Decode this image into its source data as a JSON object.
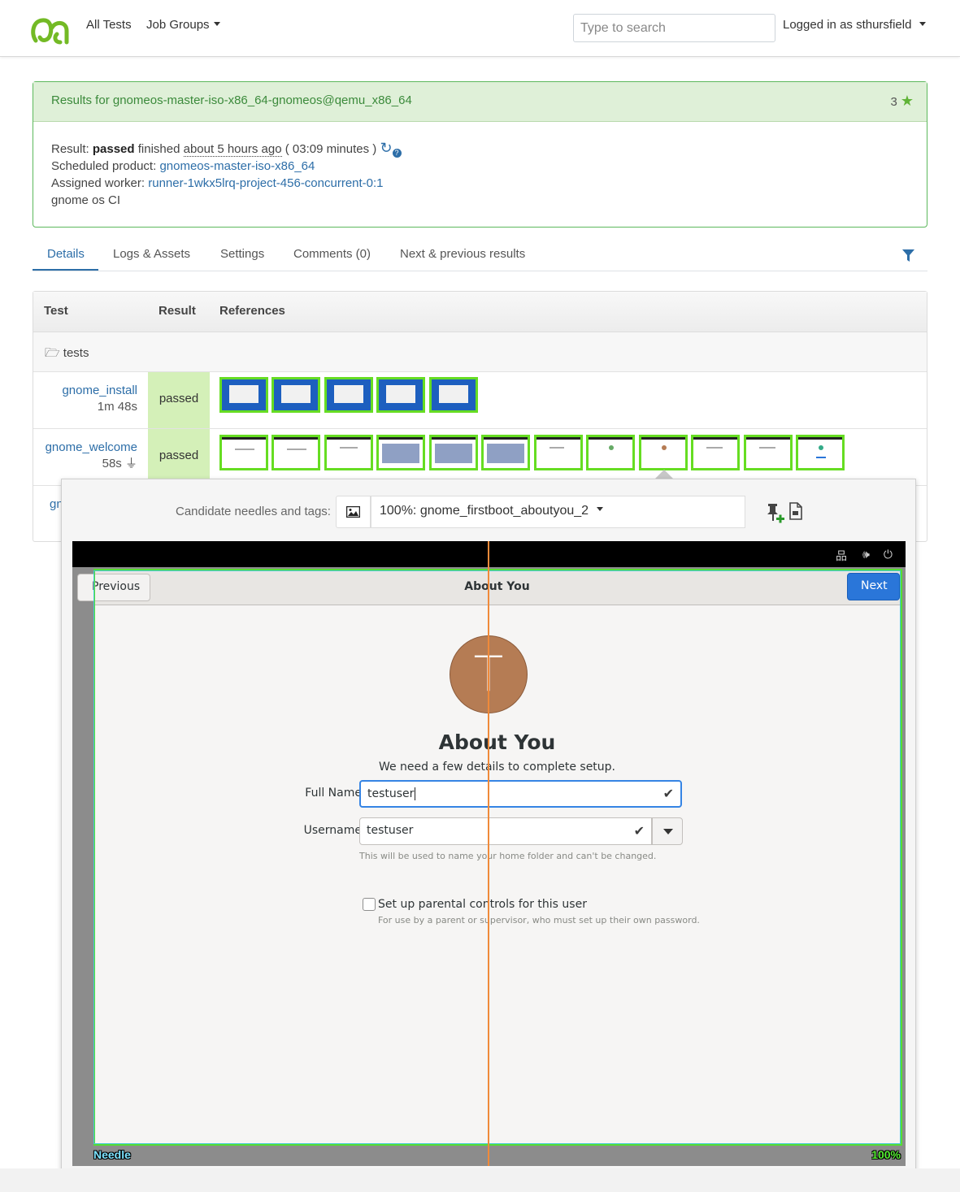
{
  "navbar": {
    "links": [
      "All Tests",
      "Job Groups"
    ],
    "search_placeholder": "Type to search",
    "user_label": "Logged in as sthursfield"
  },
  "result_card": {
    "title": "Results for gnomeos-master-iso-x86_64-gnomeos@qemu_x86_64",
    "stars": "3",
    "result_label": "Result:",
    "result_value": "passed",
    "finished_text": "finished",
    "finished_ago": "about 5 hours ago",
    "duration": "( 03:09 minutes )",
    "product_label": "Scheduled product:",
    "product_value": "gnomeos-master-iso-x86_64",
    "worker_label": "Assigned worker:",
    "worker_value": "runner-1wkx5lrq-project-456-concurrent-0:1",
    "note": "gnome os CI"
  },
  "tabs": [
    "Details",
    "Logs & Assets",
    "Settings",
    "Comments (0)",
    "Next & previous results"
  ],
  "table": {
    "headers": [
      "Test",
      "Result",
      "References"
    ],
    "folder": "tests",
    "rows": [
      {
        "name": "gnome_install",
        "duration": "1m 48s",
        "result": "passed",
        "thumb_count": 5
      },
      {
        "name": "gnome_welcome",
        "duration": "58s",
        "result": "passed",
        "thumb_count": 12
      }
    ],
    "partial_row_name": "gn"
  },
  "preview": {
    "candidate_label": "Candidate needles and tags:",
    "needle_selected": "100%: gnome_firstboot_aboutyou_2",
    "needle_tag": "Needle",
    "match_tag": "100%"
  },
  "screen": {
    "prev_button": "Previous",
    "header_title": "About You",
    "next_button": "Next",
    "avatar_letter": "T",
    "heading": "About You",
    "subheading": "We need a few details to complete setup.",
    "full_name_label": "Full Name",
    "full_name_value": "testuser",
    "username_label": "Username",
    "username_value": "testuser",
    "username_hint": "This will be used to name your home folder and can't be changed.",
    "parental_label": "Set up parental controls for this user",
    "parental_hint": "For use by a parent or supervisor, who must set up their own password."
  },
  "colors": {
    "accent": "#2d6ea8",
    "success": "#5cb85c",
    "passed_bg": "#d4f0b8",
    "gnome_blue": "#2a76d9"
  }
}
